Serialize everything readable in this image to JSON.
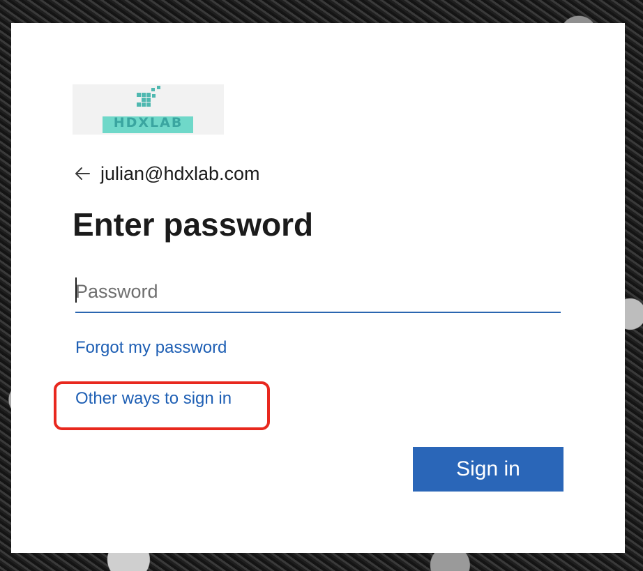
{
  "logo": {
    "text": "HDXLAB",
    "colors": {
      "band": "#6fd8c9",
      "text": "#3aa5a0",
      "mark": "#4fb8b0"
    }
  },
  "identity": {
    "back_icon": "back-arrow-icon",
    "email": "julian@hdxlab.com"
  },
  "page": {
    "title": "Enter password"
  },
  "password": {
    "placeholder": "Password",
    "value": ""
  },
  "links": {
    "forgot": "Forgot my password",
    "other_ways": "Other ways to sign in"
  },
  "buttons": {
    "sign_in": "Sign in"
  },
  "colors": {
    "accent": "#2a66b8",
    "link": "#1e5fb4",
    "highlight": "#e8281e"
  }
}
